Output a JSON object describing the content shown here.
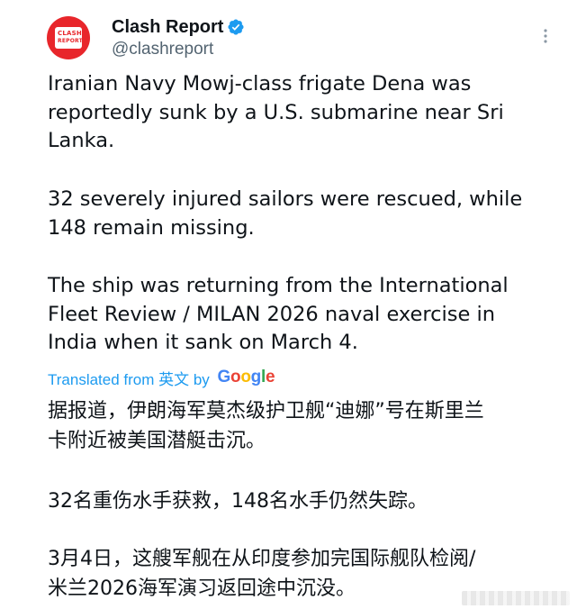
{
  "account": {
    "display_name": "Clash Report",
    "handle": "@clashreport",
    "avatar_logo_line1": "CLASH",
    "avatar_logo_line2": "REPORT"
  },
  "tweet": {
    "paragraph_1": "Iranian Navy Mowj-class frigate Dena was\nreportedly sunk by a U.S. submarine near Sri\nLanka.",
    "paragraph_2": "32 severely injured sailors were rescued, while\n148 remain missing.",
    "paragraph_3": "The ship was returning from the International\nFleet Review / MILAN 2026 naval exercise in\nIndia when it sank on March 4."
  },
  "translation": {
    "label": "Translated from 英文 by ",
    "provider": "Google",
    "paragraph_1": "据报道，伊朗海军莫杰级护卫舰“迪娜”号在斯里兰\n卡附近被美国潜艇击沉。",
    "paragraph_2": "32名重伤水手获救，148名水手仍然失踪。",
    "paragraph_3": "3月4日，这艘军舰在从印度参加完国际舰队检阅/\n米兰2026海军演习返回途中沉没。"
  },
  "colors": {
    "accent": "#1d9bf0",
    "avatar_bg": "#e8262b",
    "text": "#0f1419",
    "muted": "#536471"
  },
  "icons": {
    "verified": "verified-badge-icon",
    "more": "more-options-icon"
  }
}
